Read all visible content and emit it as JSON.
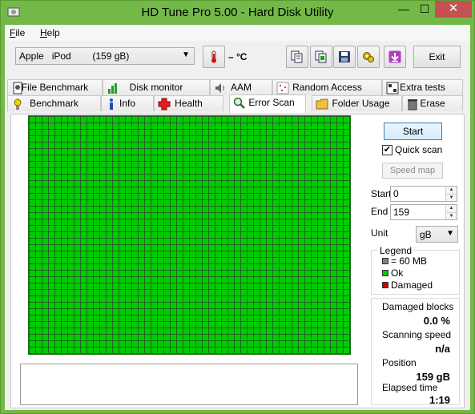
{
  "window": {
    "title": "HD Tune Pro 5.00 - Hard Disk Utility",
    "min_label": "—",
    "max_label": "☐",
    "close_label": "✕"
  },
  "menu": [
    {
      "label": "File",
      "accel": "F",
      "rest": "ile"
    },
    {
      "label": "Help",
      "accel": "H",
      "rest": "elp"
    }
  ],
  "toolbar": {
    "drive": "Apple   iPod        (159 gB)",
    "temperature": "– °C",
    "icons": [
      "copy-info-icon",
      "copy-screenshot-icon",
      "save-icon",
      "options-icon",
      "download-icon"
    ],
    "exit_label": "Exit"
  },
  "tabs": {
    "top_row": [
      {
        "label": "File Benchmark",
        "icon": "file-benchmark-icon"
      },
      {
        "label": "Disk monitor",
        "icon": "disk-monitor-icon"
      },
      {
        "label": "AAM",
        "icon": "speaker-icon"
      },
      {
        "label": "Random Access",
        "icon": "random-access-icon"
      },
      {
        "label": "Extra tests",
        "icon": "extra-tests-icon"
      }
    ],
    "bottom_row": [
      {
        "label": "Benchmark",
        "icon": "benchmark-icon"
      },
      {
        "label": "Info",
        "icon": "info-icon"
      },
      {
        "label": "Health",
        "icon": "health-cross-icon"
      },
      {
        "label": "Error Scan",
        "icon": "magnifier-icon",
        "active": true
      },
      {
        "label": "Folder Usage",
        "icon": "folder-icon"
      },
      {
        "label": "Erase",
        "icon": "trash-icon"
      }
    ]
  },
  "scan": {
    "start_label": "Start",
    "quick_scan_label": "Quick scan",
    "quick_scan_checked": true,
    "speed_map_label": "Speed map",
    "start_field_label": "Start",
    "start_value": "0",
    "end_field_label": "End",
    "end_value": "159",
    "unit_label": "Unit",
    "unit_value": "gB",
    "block_state": "ok"
  },
  "legend": {
    "title": "Legend",
    "items": [
      {
        "label": "= 60 MB",
        "color": "#808080"
      },
      {
        "label": "Ok",
        "color": "#00cc00"
      },
      {
        "label": "Damaged",
        "color": "#d00000"
      }
    ]
  },
  "stats": {
    "damaged_blocks_label": "Damaged blocks",
    "damaged_blocks_value": "0.0 %",
    "scanning_speed_label": "Scanning speed",
    "scanning_speed_value": "n/a",
    "position_label": "Position",
    "position_value": "159 gB",
    "elapsed_label": "Elapsed time",
    "elapsed_value": "1:19"
  },
  "colors": {
    "title_bar": "#73b947",
    "ok_block": "#00cc00",
    "grid_line": "#1d6a1d"
  }
}
